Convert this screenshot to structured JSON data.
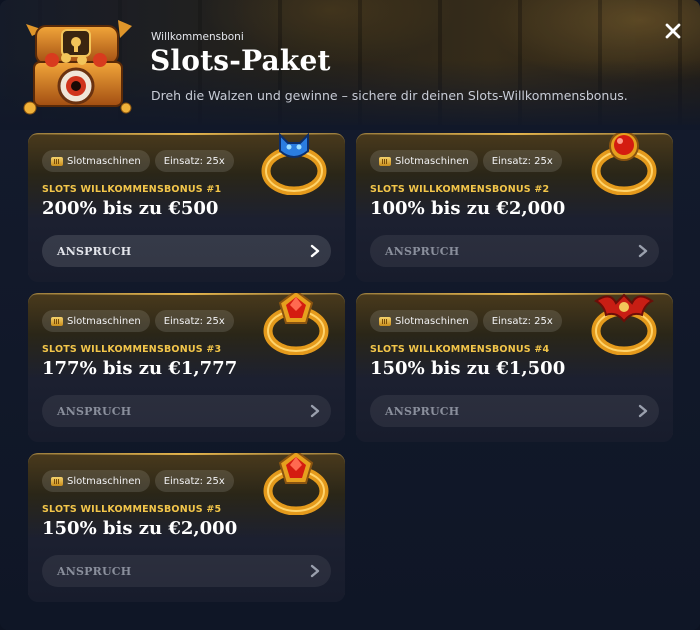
{
  "header": {
    "subtitle": "Willkommensboni",
    "title": "Slots-Paket",
    "description": "Dreh die Walzen und gewinne – sichere dir deinen Slots-Willkommensbonus."
  },
  "close_icon": "close-icon",
  "accent_color": "#f3c64a",
  "cards": [
    {
      "tag_category": "Slotmaschinen",
      "tag_wager": "Einsatz: 25x",
      "bonus_label": "SLOTS WILLKOMMENSBONUS #1",
      "bonus_value": "200% bis zu €500",
      "claim_label": "ANSPRUCH",
      "gem": "blue-demon-ring-icon"
    },
    {
      "tag_category": "Slotmaschinen",
      "tag_wager": "Einsatz: 25x",
      "bonus_label": "SLOTS WILLKOMMENSBONUS #2",
      "bonus_value": "100% bis zu €2,000",
      "claim_label": "ANSPRUCH",
      "gem": "red-orb-ring-icon"
    },
    {
      "tag_category": "Slotmaschinen",
      "tag_wager": "Einsatz: 25x",
      "bonus_label": "SLOTS WILLKOMMENSBONUS #3",
      "bonus_value": "177% bis zu €1,777",
      "claim_label": "ANSPRUCH",
      "gem": "red-gem-ring-icon"
    },
    {
      "tag_category": "Slotmaschinen",
      "tag_wager": "Einsatz: 25x",
      "bonus_label": "SLOTS WILLKOMMENSBONUS #4",
      "bonus_value": "150% bis zu €1,500",
      "claim_label": "ANSPRUCH",
      "gem": "bat-wing-ring-icon"
    },
    {
      "tag_category": "Slotmaschinen",
      "tag_wager": "Einsatz: 25x",
      "bonus_label": "SLOTS WILLKOMMENSBONUS #5",
      "bonus_value": "150% bis zu €2,000",
      "claim_label": "ANSPRUCH",
      "gem": "red-gem-ring-icon"
    }
  ]
}
